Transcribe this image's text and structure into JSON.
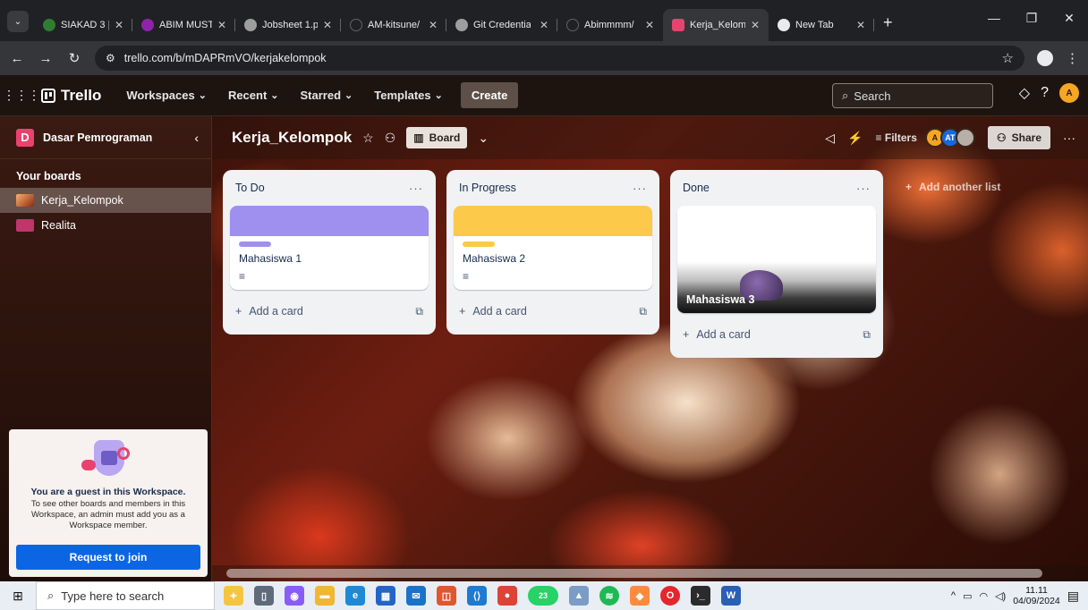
{
  "browser": {
    "tabs": [
      {
        "title": "SIAKAD 3 | S",
        "color": "#2e7d32"
      },
      {
        "title": "ABIM MUSTA",
        "color": "#8e24aa"
      },
      {
        "title": "Jobsheet 1.p",
        "color": "#9e9e9e"
      },
      {
        "title": "AM-kitsune/",
        "color": "#202124"
      },
      {
        "title": "Git Credentia",
        "color": "#9e9e9e"
      },
      {
        "title": "Abimmmm/",
        "color": "#202124"
      },
      {
        "title": "Kerja_Kelom",
        "color": "#e8436e",
        "active": true
      },
      {
        "title": "New Tab",
        "color": "#e8eaed"
      }
    ],
    "url": "trello.com/b/mDAPRmVO/kerjakelompok"
  },
  "header": {
    "brand": "Trello",
    "menus": [
      "Workspaces",
      "Recent",
      "Starred",
      "Templates"
    ],
    "create_label": "Create",
    "search_placeholder": "Search",
    "avatar_initial": "A"
  },
  "sidebar": {
    "workspace_initial": "D",
    "workspace_name": "Dasar Pemrograman",
    "section_label": "Your boards",
    "boards": [
      {
        "name": "Kerja_Kelompok",
        "active": true
      },
      {
        "name": "Realita",
        "active": false
      }
    ],
    "guest": {
      "title": "You are a guest in this Workspace.",
      "text": "To see other boards and members in this Workspace, an admin must add you as a Workspace member.",
      "button": "Request to join"
    }
  },
  "board": {
    "title": "Kerja_Kelompok",
    "view_label": "Board",
    "filters_label": "Filters",
    "share_label": "Share",
    "members": [
      "A",
      "AT"
    ],
    "add_list_label": "Add another list",
    "lists": [
      {
        "title": "To Do",
        "cards": [
          {
            "title": "Mahasiswa 1",
            "cover": "#9f8fef",
            "label": "#9f8fef"
          }
        ],
        "add_card": "Add a card"
      },
      {
        "title": "In Progress",
        "cards": [
          {
            "title": "Mahasiswa 2",
            "cover": "#fcc94b",
            "label": "#fcc94b"
          }
        ],
        "add_card": "Add a card"
      },
      {
        "title": "Done",
        "cards": [
          {
            "title": "Mahasiswa 3",
            "image": true
          }
        ],
        "add_card": "Add a card"
      }
    ]
  },
  "taskbar": {
    "search_placeholder": "Type here to search",
    "badge_count": "23",
    "time": "11.11",
    "date": "04/09/2024"
  }
}
